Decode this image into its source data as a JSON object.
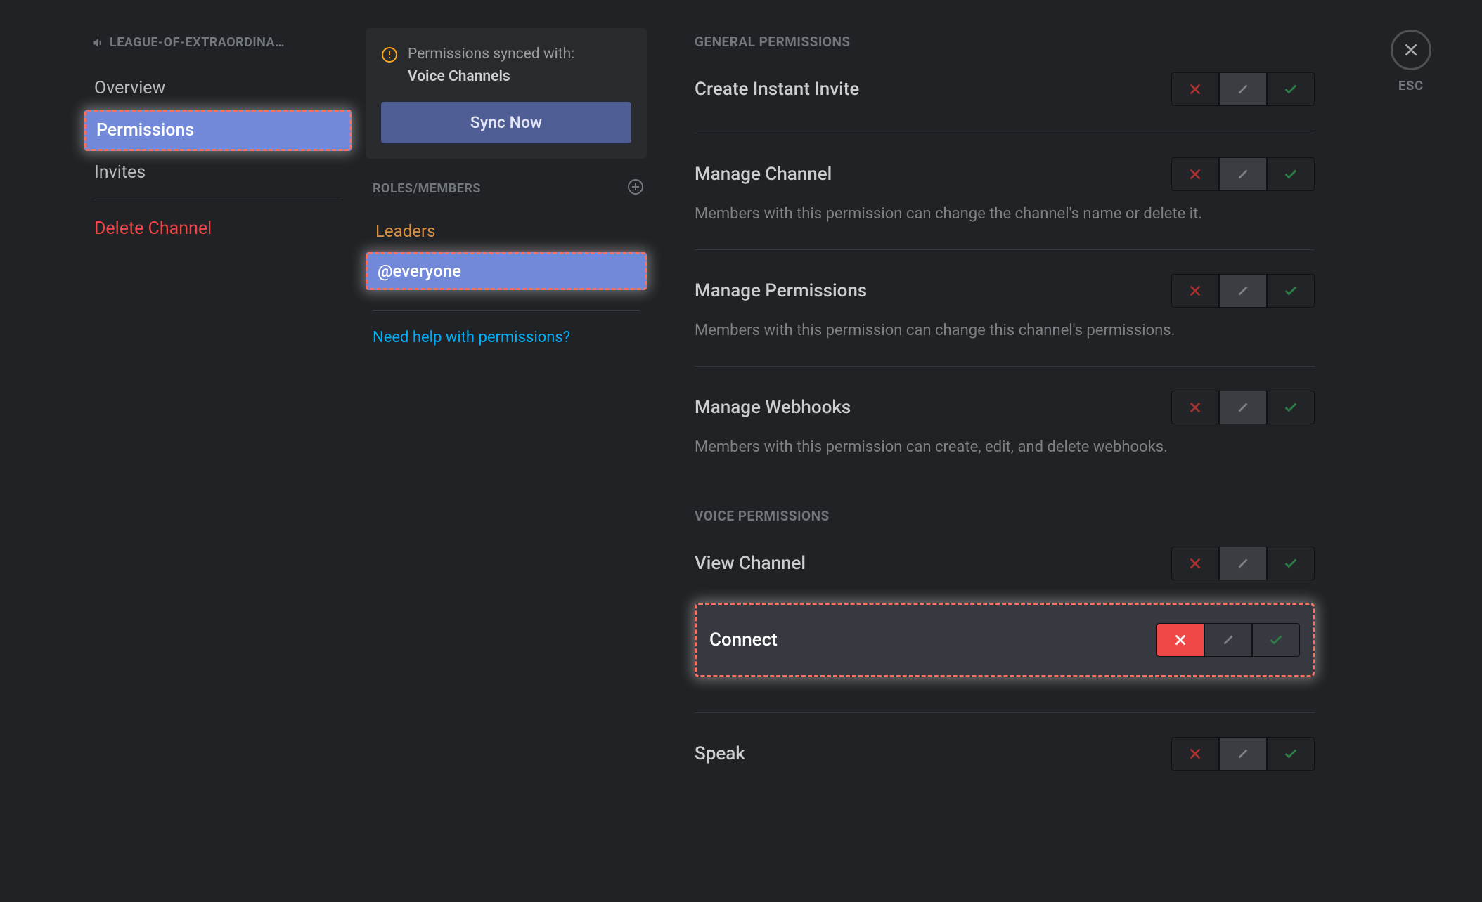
{
  "channel_name": "LEAGUE-OF-EXTRAORDINA…",
  "nav": {
    "overview": "Overview",
    "permissions": "Permissions",
    "invites": "Invites",
    "delete": "Delete Channel"
  },
  "sync": {
    "label": "Permissions synced with:",
    "category": "Voice Channels",
    "button": "Sync Now"
  },
  "roles_header": "ROLES/MEMBERS",
  "roles": {
    "leaders": "Leaders",
    "everyone": "@everyone"
  },
  "help_link": "Need help with permissions?",
  "sections": {
    "general": "GENERAL PERMISSIONS",
    "voice": "VOICE PERMISSIONS"
  },
  "perms": {
    "create_invite": {
      "label": "Create Instant Invite"
    },
    "manage_channel": {
      "label": "Manage Channel",
      "desc": "Members with this permission can change the channel's name or delete it."
    },
    "manage_permissions": {
      "label": "Manage Permissions",
      "desc": "Members with this permission can change this channel's permissions."
    },
    "manage_webhooks": {
      "label": "Manage Webhooks",
      "desc": "Members with this permission can create, edit, and delete webhooks."
    },
    "view_channel": {
      "label": "View Channel"
    },
    "connect": {
      "label": "Connect"
    },
    "speak": {
      "label": "Speak"
    }
  },
  "esc": "ESC"
}
